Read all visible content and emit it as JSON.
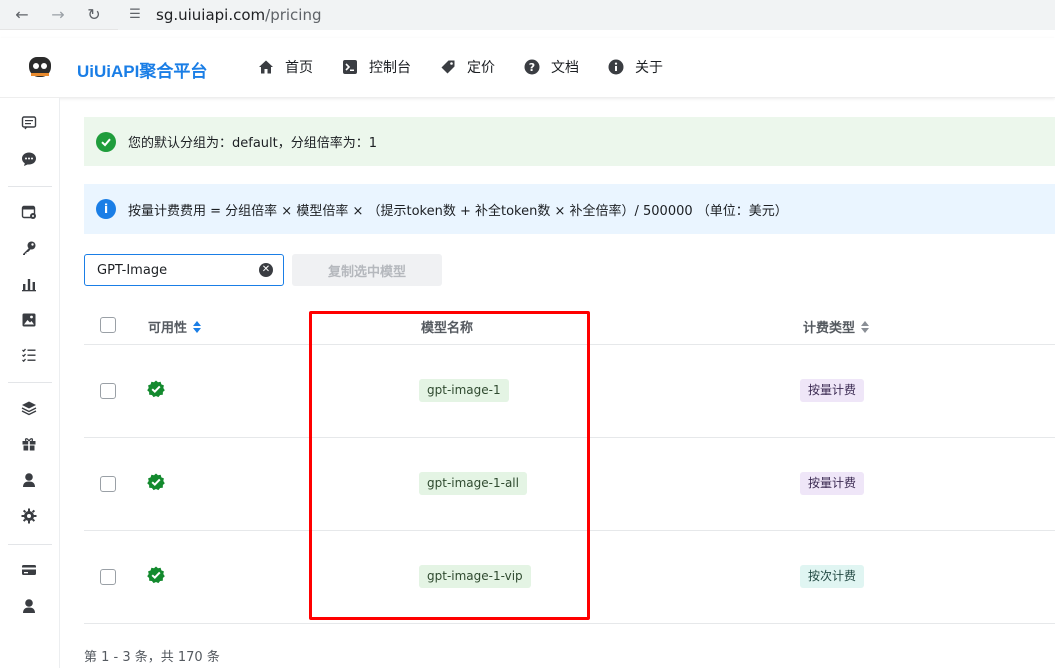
{
  "browser": {
    "url_host": "sg.uiuiapi.com",
    "url_path": "/pricing"
  },
  "header": {
    "brand": "UiUiAPI聚合平台",
    "nav": [
      {
        "label": "首页",
        "icon": "home-icon"
      },
      {
        "label": "控制台",
        "icon": "terminal-icon"
      },
      {
        "label": "定价",
        "icon": "price-tag-icon"
      },
      {
        "label": "文档",
        "icon": "help-circle-icon"
      },
      {
        "label": "关于",
        "icon": "info-circle-icon"
      }
    ]
  },
  "banners": {
    "success": "您的默认分组为：default，分组倍率为：1",
    "info": "按量计费费用 = 分组倍率 × 模型倍率 × （提示token数 + 补全token数 × 补全倍率）/ 500000 （单位：美元）"
  },
  "search": {
    "value": "GPT-Image"
  },
  "copy_button": "复制选中模型",
  "table": {
    "headers": {
      "availability": "可用性",
      "model_name": "模型名称",
      "billing_type": "计费类型"
    },
    "rows": [
      {
        "model": "gpt-image-1",
        "billing": "按量计费",
        "available": true
      },
      {
        "model": "gpt-image-1-all",
        "billing": "按量计费",
        "available": true
      },
      {
        "model": "gpt-image-1-vip",
        "billing": "按次计费",
        "available": true
      }
    ]
  },
  "pagination": "第 1 - 3 条，共 170 条",
  "colors": {
    "brand": "#1a7ee6",
    "success": "#1f9d3c",
    "info": "#1a7ee6",
    "highlight": "#ff0000"
  }
}
